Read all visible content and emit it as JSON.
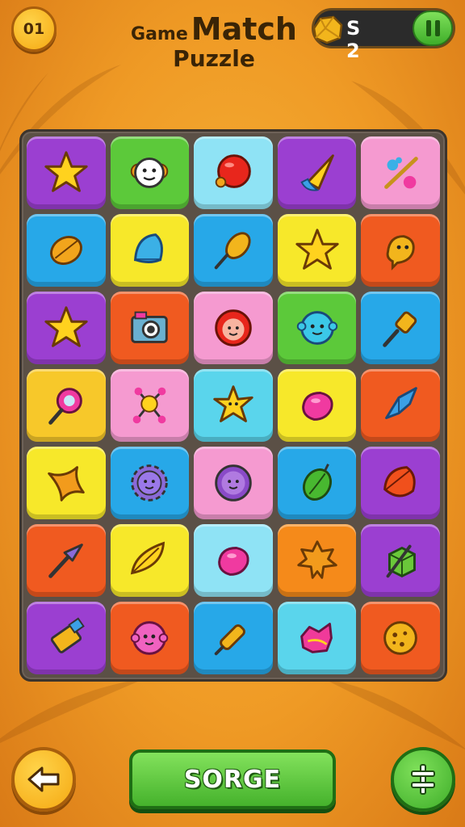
{
  "header": {
    "level_label": "01",
    "title_small": "Game",
    "title_big": "Match",
    "title_line2": "Puzzle",
    "score": "S 2"
  },
  "board": {
    "columns": 5,
    "rows": 7,
    "tiles": [
      {
        "color": "#9b3fd1",
        "icon": "star-icon"
      },
      {
        "color": "#5cc93a",
        "icon": "clown-face-icon"
      },
      {
        "color": "#8fe3f5",
        "icon": "red-ball-icon"
      },
      {
        "color": "#9b3fd1",
        "icon": "cone-icon"
      },
      {
        "color": "#f59ad0",
        "icon": "brush-icon"
      },
      {
        "color": "#27a8e8",
        "icon": "seed-icon"
      },
      {
        "color": "#f7e82a",
        "icon": "blue-shell-icon"
      },
      {
        "color": "#27a8e8",
        "icon": "corn-icon"
      },
      {
        "color": "#f7e82a",
        "icon": "star-icon"
      },
      {
        "color": "#f05a20",
        "icon": "yellow-blob-icon"
      },
      {
        "color": "#9b3fd1",
        "icon": "star-icon"
      },
      {
        "color": "#f05a20",
        "icon": "camera-icon"
      },
      {
        "color": "#f59ad0",
        "icon": "red-flower-face-icon"
      },
      {
        "color": "#5cc93a",
        "icon": "blue-face-icon"
      },
      {
        "color": "#27a8e8",
        "icon": "paintbrush-icon"
      },
      {
        "color": "#f7c82a",
        "icon": "magnifier-icon"
      },
      {
        "color": "#f59ad0",
        "icon": "molecule-icon"
      },
      {
        "color": "#5ad5ec",
        "icon": "yellow-star-creature-icon"
      },
      {
        "color": "#f7e82a",
        "icon": "pink-blob-icon"
      },
      {
        "color": "#f05a20",
        "icon": "blue-gem-icon"
      },
      {
        "color": "#f7e82a",
        "icon": "orange-starfish-icon"
      },
      {
        "color": "#27a8e8",
        "icon": "gear-face-icon"
      },
      {
        "color": "#f59ad0",
        "icon": "purple-face-icon"
      },
      {
        "color": "#27a8e8",
        "icon": "green-fruit-icon"
      },
      {
        "color": "#9b3fd1",
        "icon": "orange-leaf-icon"
      },
      {
        "color": "#f05a20",
        "icon": "arrowhead-icon"
      },
      {
        "color": "#f7e82a",
        "icon": "yellow-leaf-icon"
      },
      {
        "color": "#8fe3f5",
        "icon": "pink-blob-icon"
      },
      {
        "color": "#f58a1a",
        "icon": "maple-leaf-icon"
      },
      {
        "color": "#9b3fd1",
        "icon": "green-cube-icon"
      },
      {
        "color": "#9b3fd1",
        "icon": "usb-icon"
      },
      {
        "color": "#f05a20",
        "icon": "pink-face-icon"
      },
      {
        "color": "#27a8e8",
        "icon": "marker-icon"
      },
      {
        "color": "#5ad5ec",
        "icon": "pink-flower-icon"
      },
      {
        "color": "#f05a20",
        "icon": "cookie-icon"
      }
    ]
  },
  "footer": {
    "back_icon": "arrow-left-icon",
    "main_button_label": "SORGE",
    "menu_icon": "menu-icon"
  }
}
